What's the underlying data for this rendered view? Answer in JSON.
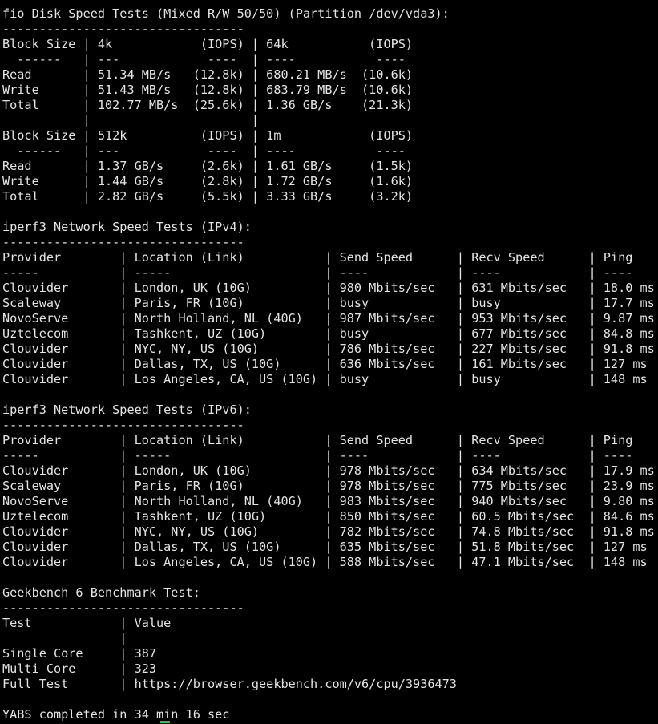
{
  "terminal": {
    "lines": [
      "fio Disk Speed Tests (Mixed R/W 50/50) (Partition /dev/vda3):",
      "---------------------------------",
      "Block Size | 4k            (IOPS) | 64k           (IOPS)",
      "  ------   | ---            ----  | ----           ----",
      "Read       | 51.34 MB/s   (12.8k) | 680.21 MB/s  (10.6k)",
      "Write      | 51.43 MB/s   (12.8k) | 683.79 MB/s  (10.6k)",
      "Total      | 102.77 MB/s  (25.6k) | 1.36 GB/s    (21.3k)",
      "           |                      |",
      "Block Size | 512k          (IOPS) | 1m            (IOPS)",
      "  ------   | ---            ----  | ----           ----",
      "Read       | 1.37 GB/s     (2.6k) | 1.61 GB/s     (1.5k)",
      "Write      | 1.44 GB/s     (2.8k) | 1.72 GB/s     (1.6k)",
      "Total      | 2.82 GB/s     (5.5k) | 3.33 GB/s     (3.2k)",
      "",
      "iperf3 Network Speed Tests (IPv4):",
      "---------------------------------",
      "Provider        | Location (Link)           | Send Speed      | Recv Speed      | Ping",
      "-----           | -----                     | ----            | ----            | ----",
      "Clouvider       | London, UK (10G)          | 980 Mbits/sec   | 631 Mbits/sec   | 18.0 ms",
      "Scaleway        | Paris, FR (10G)           | busy            | busy            | 17.7 ms",
      "NovoServe       | North Holland, NL (40G)   | 987 Mbits/sec   | 953 Mbits/sec   | 9.87 ms",
      "Uztelecom       | Tashkent, UZ (10G)        | busy            | 677 Mbits/sec   | 84.8 ms",
      "Clouvider       | NYC, NY, US (10G)         | 786 Mbits/sec   | 227 Mbits/sec   | 91.8 ms",
      "Clouvider       | Dallas, TX, US (10G)      | 636 Mbits/sec   | 161 Mbits/sec   | 127 ms",
      "Clouvider       | Los Angeles, CA, US (10G) | busy            | busy            | 148 ms",
      "",
      "iperf3 Network Speed Tests (IPv6):",
      "---------------------------------",
      "Provider        | Location (Link)           | Send Speed      | Recv Speed      | Ping",
      "-----           | -----                     | ----            | ----            | ----",
      "Clouvider       | London, UK (10G)          | 978 Mbits/sec   | 634 Mbits/sec   | 17.9 ms",
      "Scaleway        | Paris, FR (10G)           | 978 Mbits/sec   | 775 Mbits/sec   | 23.9 ms",
      "NovoServe       | North Holland, NL (40G)   | 983 Mbits/sec   | 940 Mbits/sec   | 9.80 ms",
      "Uztelecom       | Tashkent, UZ (10G)        | 850 Mbits/sec   | 60.5 Mbits/sec  | 84.6 ms",
      "Clouvider       | NYC, NY, US (10G)         | 782 Mbits/sec   | 74.8 Mbits/sec  | 91.8 ms",
      "Clouvider       | Dallas, TX, US (10G)      | 635 Mbits/sec   | 51.8 Mbits/sec  | 127 ms",
      "Clouvider       | Los Angeles, CA, US (10G) | 588 Mbits/sec   | 47.1 Mbits/sec  | 148 ms",
      "",
      "Geekbench 6 Benchmark Test:",
      "---------------------------------",
      "Test            | Value",
      "                |",
      "Single Core     | 387",
      "Multi Core      | 323",
      "Full Test       | https://browser.geekbench.com/v6/cpu/3936473",
      "",
      "YABS completed in 34 min 16 sec"
    ],
    "colors": {
      "background": "#000000",
      "foreground": "#e4e4e4",
      "cursor": "#2ec24a"
    }
  }
}
